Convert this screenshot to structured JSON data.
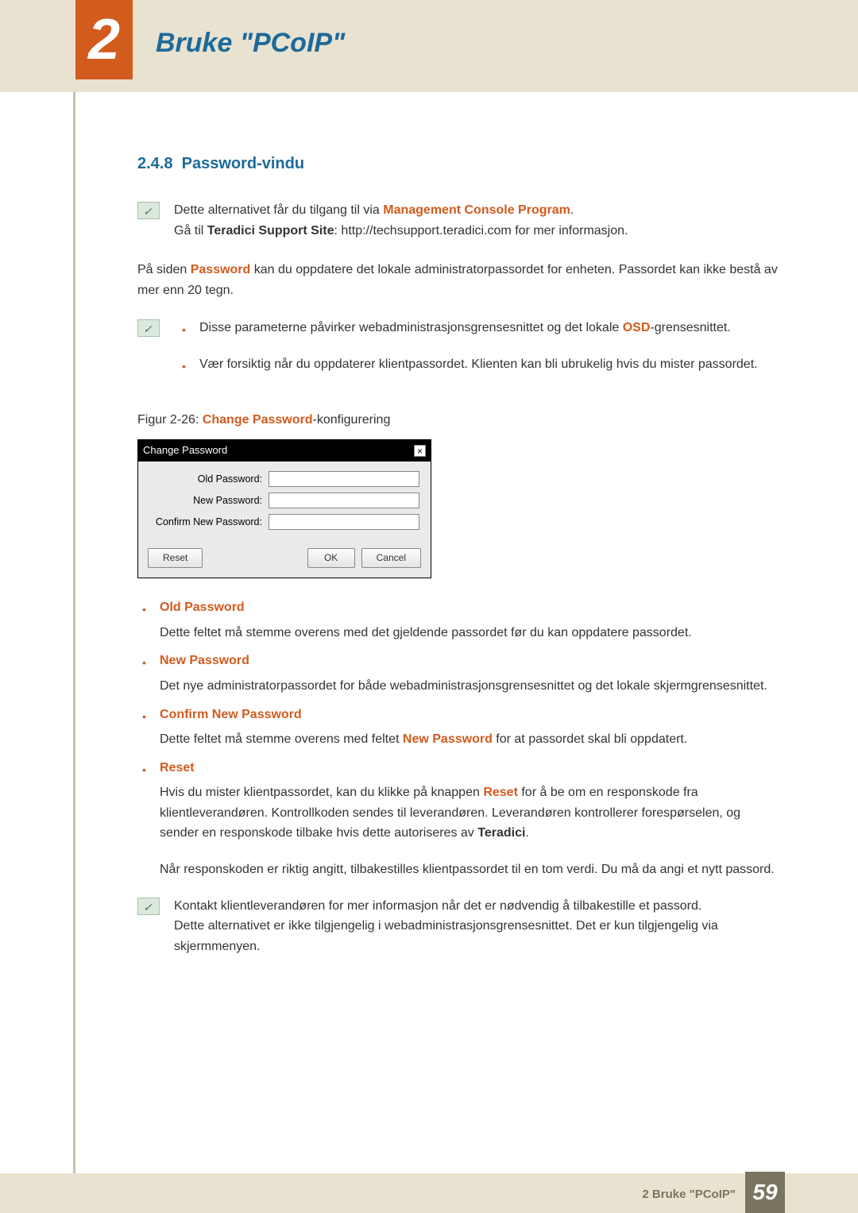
{
  "chapter": {
    "number": "2",
    "title": "Bruke \"PCoIP\""
  },
  "section": {
    "number": "2.4.8",
    "title": "Password-vindu"
  },
  "note1": {
    "line1_pre": "Dette alternativet får du tilgang til via ",
    "line1_hl": "Management Console Program",
    "line1_post": ".",
    "line2_pre": "Gå til ",
    "line2_bold": "Teradici Support Site",
    "line2_post": ": http://techsupport.teradici.com for mer informasjon."
  },
  "intro": {
    "pre": "På siden ",
    "hl": "Password",
    "post": " kan du oppdatere det lokale administratorpassordet for enheten. Passordet kan ikke bestå av mer enn 20 tegn."
  },
  "note2": {
    "b1_pre": "Disse parameterne påvirker webadministrasjonsgrensesnittet og det lokale ",
    "b1_hl": "OSD",
    "b1_post": "-grensesnittet.",
    "b2": "Vær forsiktig når du oppdaterer klientpassordet. Klienten kan bli ubrukelig hvis du mister passordet."
  },
  "figcap": {
    "pre": "Figur 2-26: ",
    "hl": "Change Password",
    "post": "-konfigurering"
  },
  "dialog": {
    "title": "Change Password",
    "close": "×",
    "old": "Old Password:",
    "new": "New Password:",
    "confirm": "Confirm New Password:",
    "reset": "Reset",
    "ok": "OK",
    "cancel": "Cancel"
  },
  "defs": {
    "old": {
      "term": "Old Password",
      "def": "Dette feltet må stemme overens med det gjeldende passordet før du kan oppdatere passordet."
    },
    "new": {
      "term": "New Password",
      "def": "Det nye administratorpassordet for både webadministrasjonsgrensesnittet og det lokale skjermgrensesnittet."
    },
    "confirm": {
      "term": "Confirm New Password",
      "def_pre": "Dette feltet må stemme overens med feltet ",
      "def_hl": "New Password",
      "def_post": " for at passordet skal bli oppdatert."
    },
    "reset": {
      "term": "Reset",
      "p1_pre": "Hvis du mister klientpassordet, kan du klikke på knappen ",
      "p1_hl": "Reset",
      "p1_mid": " for å be om en responskode fra klientleverandøren. Kontrollkoden sendes til leverandøren. Leverandøren kontrollerer forespørselen, og sender en responskode tilbake hvis dette autoriseres av ",
      "p1_bold": "Teradici",
      "p1_post": ".",
      "p2": "Når responskoden er riktig angitt, tilbakestilles klientpassordet til en tom verdi. Du må da angi et nytt passord."
    }
  },
  "note3": {
    "l1": "Kontakt klientleverandøren for mer informasjon når det er nødvendig å tilbakestille et passord.",
    "l2": "Dette alternativet er ikke tilgjengelig i webadministrasjonsgrensesnittet. Det er kun tilgjengelig via skjermmenyen."
  },
  "footer": {
    "text": "2 Bruke \"PCoIP\"",
    "page": "59"
  }
}
